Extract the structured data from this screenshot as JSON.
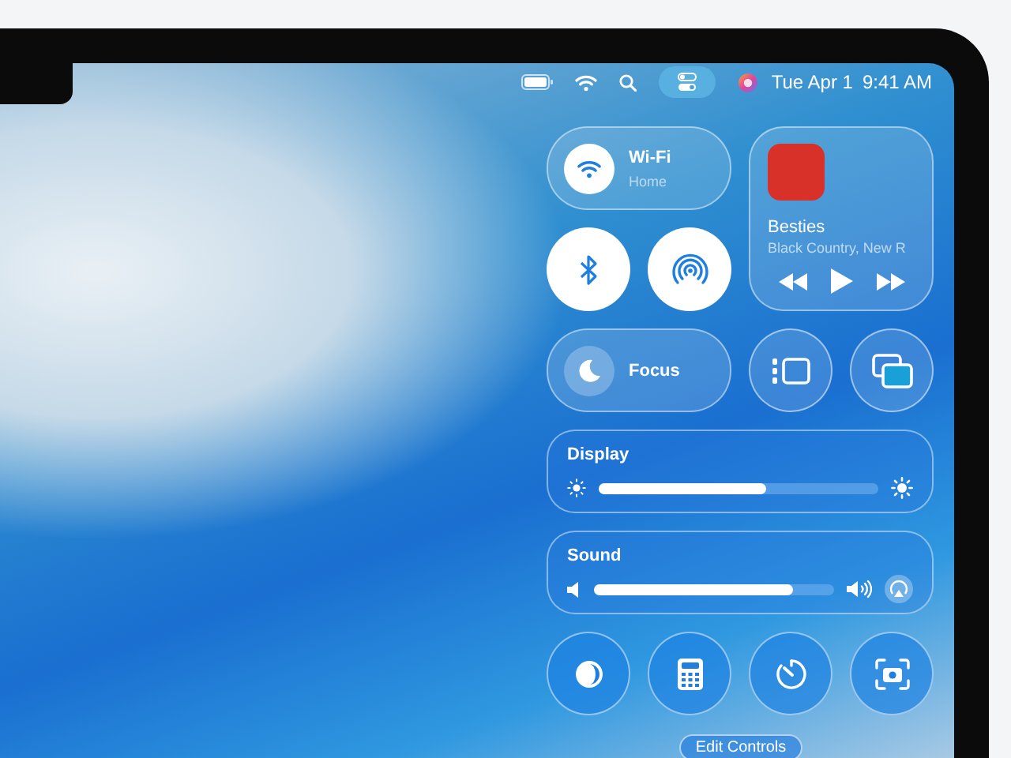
{
  "menu_bar": {
    "control_center_selected": true,
    "date": "Tue Apr 1",
    "time": "9:41 AM"
  },
  "wifi": {
    "title": "Wi-Fi",
    "subtitle": "Home",
    "on": true
  },
  "now_playing": {
    "title": "Besties",
    "artist": "Black Country, New R"
  },
  "bluetooth": {
    "on": true
  },
  "airdrop": {
    "on": true
  },
  "focus": {
    "label": "Focus",
    "on": false
  },
  "sliders": [
    {
      "kind": "display",
      "label": "Display",
      "level": 0.6
    },
    {
      "kind": "sound",
      "label": "Sound",
      "level": 0.83
    }
  ],
  "shortcuts": [
    {
      "kind": "dark-mode"
    },
    {
      "kind": "calculator"
    },
    {
      "kind": "timer"
    },
    {
      "kind": "screenshot"
    }
  ],
  "edit_button": "Edit Controls"
}
